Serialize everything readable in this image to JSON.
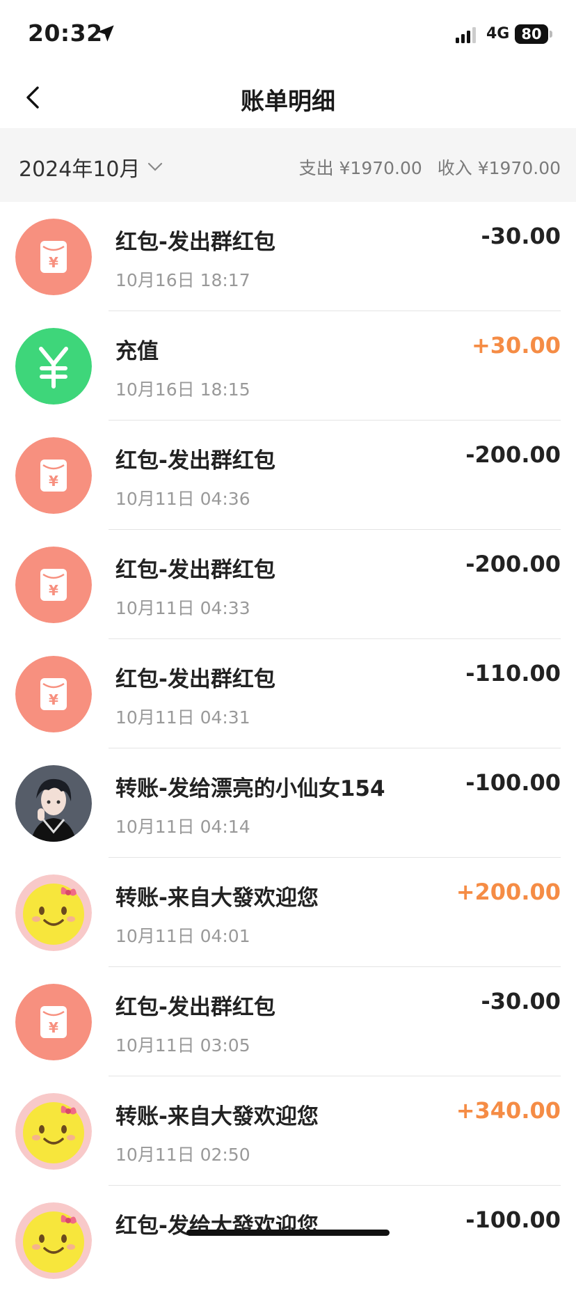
{
  "status": {
    "time": "20:32",
    "network": "4G",
    "battery": "80"
  },
  "nav": {
    "title": "账单明细"
  },
  "filter": {
    "month": "2024年10月",
    "expense": "支出 ¥1970.00",
    "income": "收入 ¥1970.00"
  },
  "transactions": [
    {
      "icon": "red-envelope-icon",
      "title": "红包-发出群红包",
      "time": "10月16日 18:17",
      "amount": "-30.00",
      "type": "expense"
    },
    {
      "icon": "yuan-icon",
      "title": "充值",
      "time": "10月16日 18:15",
      "amount": "+30.00",
      "type": "income"
    },
    {
      "icon": "red-envelope-icon",
      "title": "红包-发出群红包",
      "time": "10月11日 04:36",
      "amount": "-200.00",
      "type": "expense"
    },
    {
      "icon": "red-envelope-icon",
      "title": "红包-发出群红包",
      "time": "10月11日 04:33",
      "amount": "-200.00",
      "type": "expense"
    },
    {
      "icon": "red-envelope-icon",
      "title": "红包-发出群红包",
      "time": "10月11日 04:31",
      "amount": "-110.00",
      "type": "expense"
    },
    {
      "icon": "anime-avatar",
      "title": "转账-发给漂亮的小仙女154",
      "time": "10月11日 04:14",
      "amount": "-100.00",
      "type": "expense"
    },
    {
      "icon": "smiley-avatar",
      "title": "转账-来自大發欢迎您",
      "time": "10月11日 04:01",
      "amount": "+200.00",
      "type": "income"
    },
    {
      "icon": "red-envelope-icon",
      "title": "红包-发出群红包",
      "time": "10月11日 03:05",
      "amount": "-30.00",
      "type": "expense"
    },
    {
      "icon": "smiley-avatar",
      "title": "转账-来自大發欢迎您",
      "time": "10月11日 02:50",
      "amount": "+340.00",
      "type": "income"
    },
    {
      "icon": "smiley-avatar",
      "title": "红包-发给大發欢迎您",
      "time": "",
      "amount": "-100.00",
      "type": "expense"
    }
  ],
  "colors": {
    "red_envelope": "#f7907f",
    "yuan": "#3ed67a",
    "income": "#f58c45",
    "expense": "#222222"
  }
}
